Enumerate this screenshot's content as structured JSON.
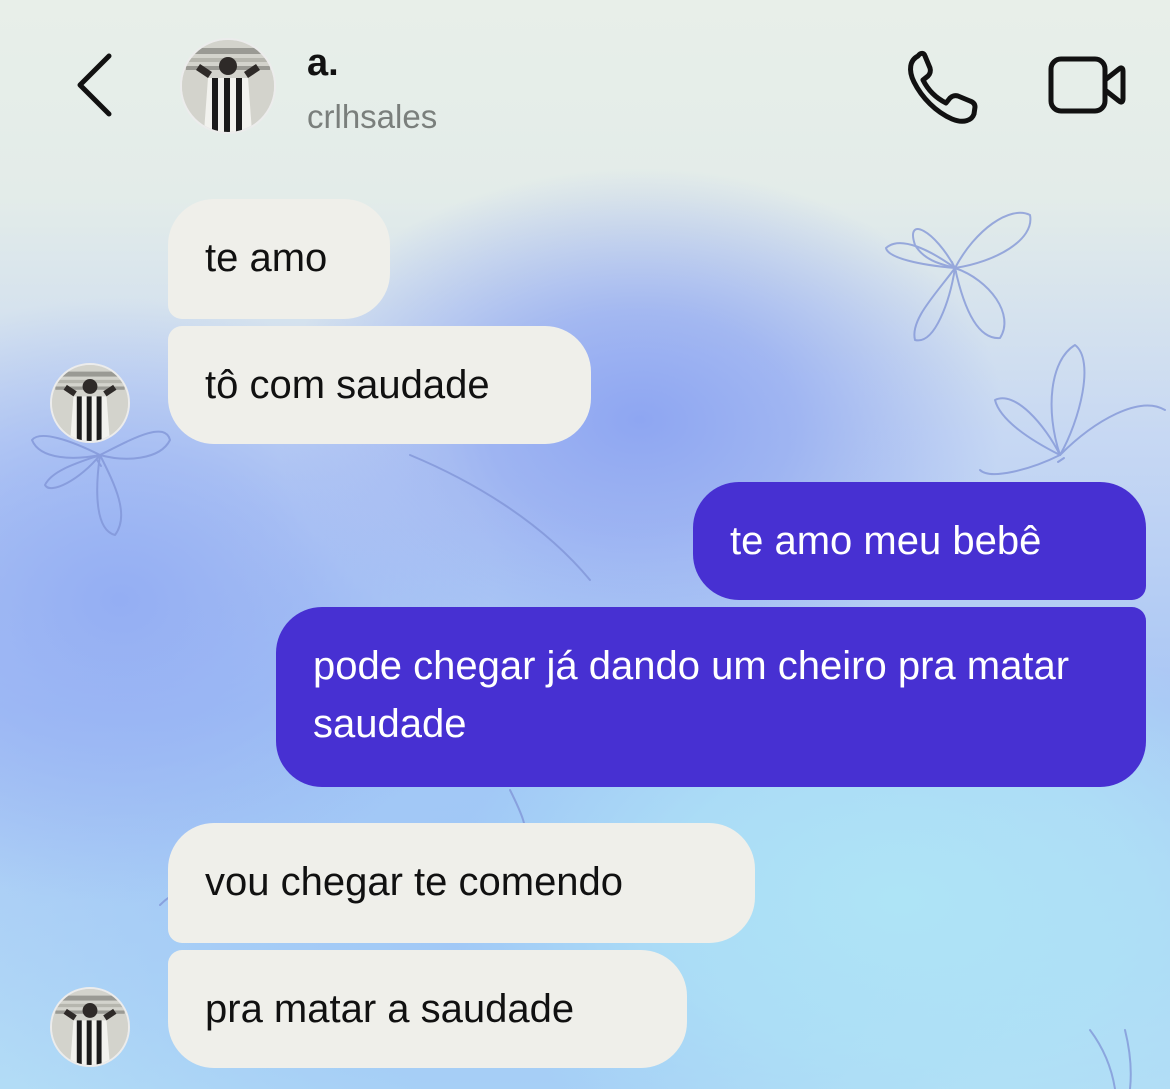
{
  "header": {
    "back_icon": "chevron-left-icon",
    "avatar_icon": "profile-photo-avatar",
    "name": "a.",
    "username": "crlhsales",
    "call_icon": "phone-icon",
    "video_icon": "video-camera-icon"
  },
  "theme": {
    "incoming_bubble_color": "#efefea",
    "outgoing_bubble_color": "#4730d2",
    "incoming_text_color": "#111111",
    "outgoing_text_color": "#ffffff"
  },
  "messages": [
    {
      "direction": "incoming",
      "text": "te amo"
    },
    {
      "direction": "incoming",
      "text": "tô com saudade"
    },
    {
      "direction": "outgoing",
      "text": "te amo meu bebê"
    },
    {
      "direction": "outgoing",
      "text": "pode chegar já dando um cheiro pra matar saudade"
    },
    {
      "direction": "incoming",
      "text": "vou chegar te comendo"
    },
    {
      "direction": "incoming",
      "text": "pra matar a saudade"
    }
  ]
}
